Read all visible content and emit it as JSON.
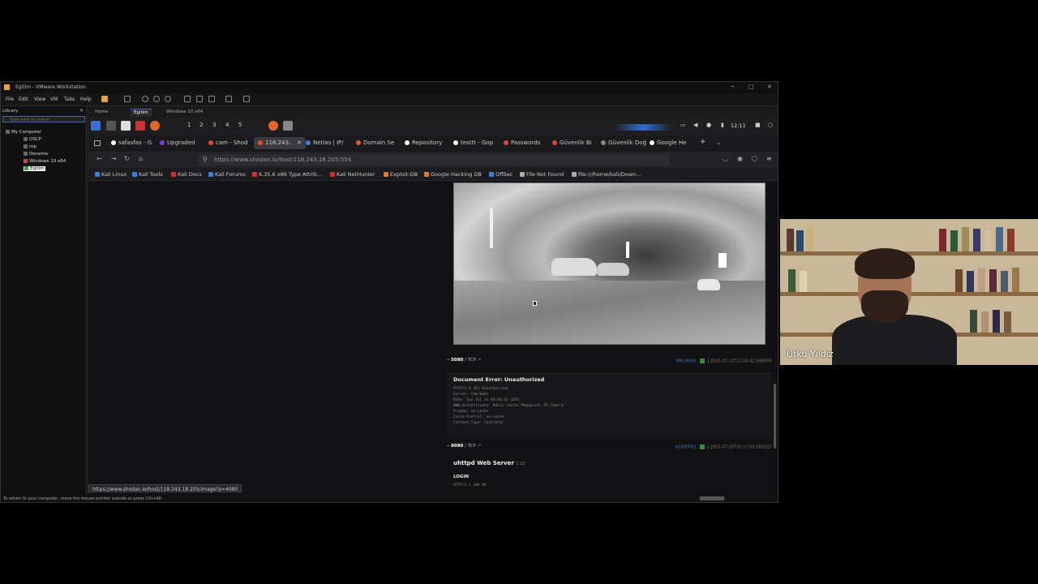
{
  "vmware": {
    "title": "Egitim - VMware Workstation",
    "menus": [
      "File",
      "Edit",
      "View",
      "VM",
      "Tabs",
      "Help"
    ],
    "library_title": "Library",
    "library_search_placeholder": "Type here to search",
    "library_items": [
      "My Computer",
      "OSCP",
      "rop",
      "Deneme",
      "Windows 10 x64",
      "Egitim"
    ],
    "vm_tabs": [
      "Home",
      "Egitim",
      "Windows 10 x64"
    ],
    "status_text": "To return to your computer, move the mouse pointer outside or press Ctrl+Alt."
  },
  "kali": {
    "workspaces": [
      "1",
      "2",
      "3",
      "4",
      "5"
    ],
    "clock": "12:11"
  },
  "firefox": {
    "tabs": [
      {
        "label": "safasfas - G",
        "fav": "#ffffff"
      },
      {
        "label": "Upgraded",
        "fav": "#7a3fd1"
      },
      {
        "label": "cam - Shod",
        "fav": "#e04a2f"
      },
      {
        "label": "118.243.",
        "fav": "#e04a2f",
        "active": true
      },
      {
        "label": "Netlas | IP/",
        "fav": "#3d7fd6"
      },
      {
        "label": "Domain Se",
        "fav": "#e05a2f"
      },
      {
        "label": "Repository",
        "fav": "#ffffff"
      },
      {
        "label": "testtt - Gop",
        "fav": "#ffffff"
      },
      {
        "label": "Passwords",
        "fav": "#e0472f"
      },
      {
        "label": "Güvenlik Bi",
        "fav": "#e0472f"
      },
      {
        "label": "Güvenlik Doğ",
        "fav": "#888888"
      },
      {
        "label": "Google He",
        "fav": "#ffffff"
      }
    ],
    "url": "https://www.shodan.io/host/118.243.18.205:554",
    "bookmarks": [
      {
        "label": "Kali Linux",
        "fav": "#3d7fd6"
      },
      {
        "label": "Kali Tools",
        "fav": "#3d7fd6"
      },
      {
        "label": "Kali Docs",
        "fav": "#d62d2d"
      },
      {
        "label": "Kali Forums",
        "fav": "#3d7fd6"
      },
      {
        "label": "6.35.6 x86 Type Attrib...",
        "fav": "#d62d2d"
      },
      {
        "label": "Kali NetHunter",
        "fav": "#d62d2d"
      },
      {
        "label": "Exploit-DB",
        "fav": "#e07a2f"
      },
      {
        "label": "Google Hacking DB",
        "fav": "#e07a2f"
      },
      {
        "label": "OffSec",
        "fav": "#3d7fd6"
      },
      {
        "label": "File Not Found",
        "fav": "#aaaaaa"
      },
      {
        "label": "file:///home/kali/Down...",
        "fav": "#aaaaaa"
      }
    ],
    "hover_link": "https://www.shodan.io/host/118.243.18.205/image?p=4080"
  },
  "shodan": {
    "ports": [
      {
        "port": "5080",
        "proto": "/ TCP",
        "tag": "8f6c90bfc",
        "timestamp": "2025-07-13T11:04:42.948809",
        "title": "Document Error: Unauthorized",
        "banner": "HTTP/1.0 401 Unauthorized\nServer: Cam-Webs\nDate: Sun Jul 13 04:04:42 2025\nWWW-Authenticate: Basic realm=\"Megapixel_IP_Camera\"\nPragma: no-cache\nCache-Control: no-cache\nContent-Type: text/html"
      },
      {
        "port": "8080",
        "proto": "/ TCP",
        "tag": "b2b0f7f51",
        "timestamp": "2025-07-10T20:17:03.183325",
        "title": "uhttpd Web Server",
        "version": "1.22",
        "subtitle": "LOGIN",
        "banner": "HTTP/1.1 200 OK"
      }
    ]
  },
  "webcam": {
    "name": "Utku Yıldız"
  }
}
